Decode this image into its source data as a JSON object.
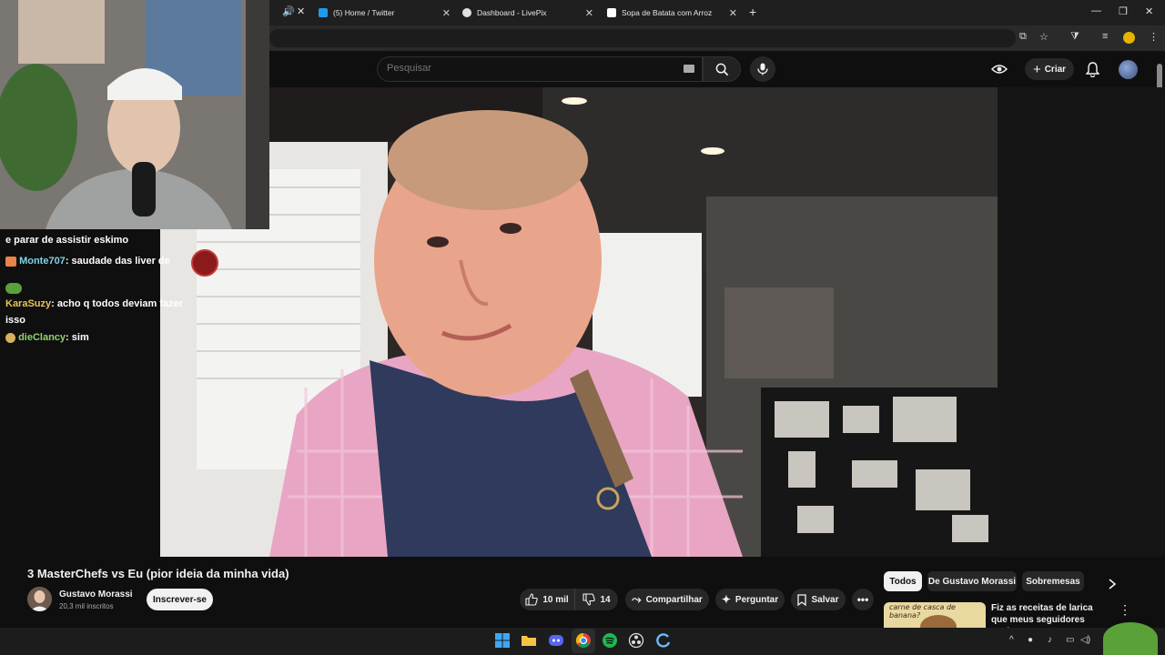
{
  "browser": {
    "tabs": [
      {
        "label": "(5) Home / Twitter",
        "favicon": "twitter-icon"
      },
      {
        "label": "Dashboard - LivePix",
        "favicon": "livepix-icon"
      },
      {
        "label": "Sopa de Batata com Arroz",
        "favicon": "page-icon"
      }
    ],
    "new_tab": "+"
  },
  "youtube": {
    "search_placeholder": "Pesquisar",
    "create_label": "Criar"
  },
  "chat": {
    "messages": [
      {
        "user": "",
        "text": "e parar de assistir eskimo",
        "user_color": "#ffffff"
      },
      {
        "user": "Monte707",
        "text": "saudade das liver de",
        "user_color": "#7fd4e8"
      },
      {
        "user": "KaraSuzy",
        "text": "acho q todos deviam fazer",
        "user_color": "#e8c35a"
      },
      {
        "user": "",
        "text": "isso",
        "user_color": "#ffffff"
      },
      {
        "user": "dieClancy",
        "text": "sim",
        "user_color": "#8fd36b"
      }
    ]
  },
  "video": {
    "title": "3 MasterChefs vs Eu (pior ideia da minha vida)",
    "channel": "Gustavo Morassi",
    "subscribers": "20,3 mil inscritos",
    "subscribe_label": "Inscrever-se",
    "likes": "10 mil",
    "dislikes": "14",
    "share_label": "Compartilhar",
    "ask_label": "Perguntar",
    "save_label": "Salvar"
  },
  "chips": [
    "Todos",
    "De Gustavo Morassi",
    "Sobremesas"
  ],
  "recommendation": {
    "thumb_text": "carne de casca de banana?",
    "title": "Fiz as receitas de larica que meus seguidores enviaram"
  },
  "colors": {
    "youtube_bg": "#0f0f0f",
    "pill_bg": "#272727",
    "accent_text": "#f1f1f1"
  }
}
